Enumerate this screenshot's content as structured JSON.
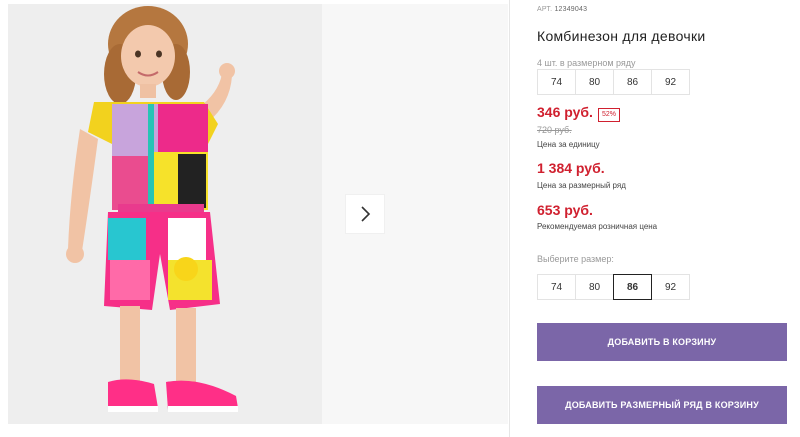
{
  "product": {
    "article_label": "АРТ.",
    "article": "12349043",
    "title": "Комбинезон для девочки",
    "series_caption": "4 шт. в размерном ряду",
    "series_sizes": [
      "74",
      "80",
      "86",
      "92"
    ],
    "price_unit": "346 руб.",
    "discount": "52%",
    "old_price": "720 руб.",
    "price_unit_caption": "Цена за единицу",
    "price_series": "1 384 руб.",
    "price_series_caption": "Цена за размерный ряд",
    "price_retail": "653 руб.",
    "price_retail_caption": "Рекомендуемая розничная цена",
    "choose_size_caption": "Выберите размер:",
    "choose_sizes": [
      "74",
      "80",
      "86",
      "92"
    ],
    "selected_size": "86",
    "add_to_cart": "ДОБАВИТЬ В КОРЗИНУ",
    "add_series_to_cart": "ДОБАВИТЬ РАЗМЕРНЫЙ РЯД В КОРЗИНУ"
  },
  "colors": {
    "price_red": "#d0202f",
    "button_purple": "#7b66a8"
  },
  "icons": {
    "gallery_next": "chevron-right-icon"
  }
}
